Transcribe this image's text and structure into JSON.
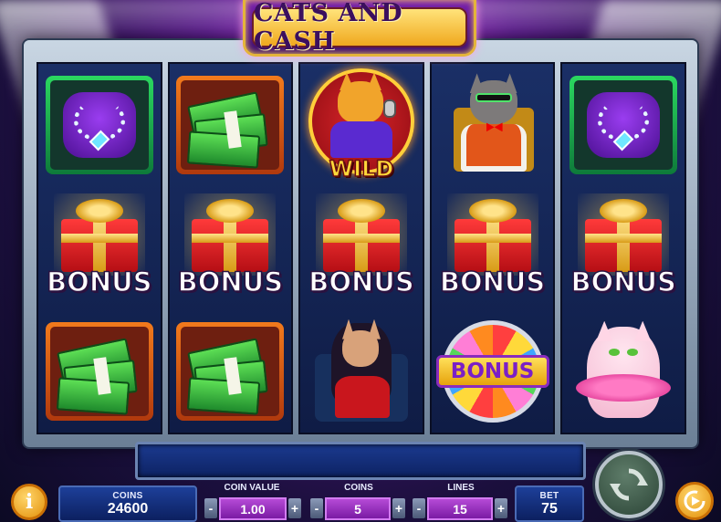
{
  "game": {
    "title": "CATS AND CASH"
  },
  "reels": [
    [
      "jewels",
      "bonus-gift",
      "cash"
    ],
    [
      "cash",
      "bonus-gift",
      "cash"
    ],
    [
      "wild-cat",
      "bonus-gift",
      "lady-cat"
    ],
    [
      "boss-cat",
      "bonus-gift",
      "bonus-wheel"
    ],
    [
      "jewels",
      "bonus-gift",
      "pink-cat"
    ]
  ],
  "symbols": {
    "bonus_text": "BONUS",
    "wild_text": "WILD",
    "wheel_text": "BONUS"
  },
  "controls": {
    "info_label": "i",
    "coins_label": "COINS",
    "coins_value": "24600",
    "coin_value_label": "COIN VALUE",
    "coin_value": "1.00",
    "coins_bet_label": "COINS",
    "coins_bet_value": "5",
    "lines_label": "LINES",
    "lines_value": "15",
    "bet_label": "BET",
    "bet_value": "75",
    "minus": "-",
    "plus": "+"
  },
  "icons": {
    "spin": "spin-arrows-icon",
    "autoplay": "autoplay-icon",
    "info": "info-icon"
  }
}
